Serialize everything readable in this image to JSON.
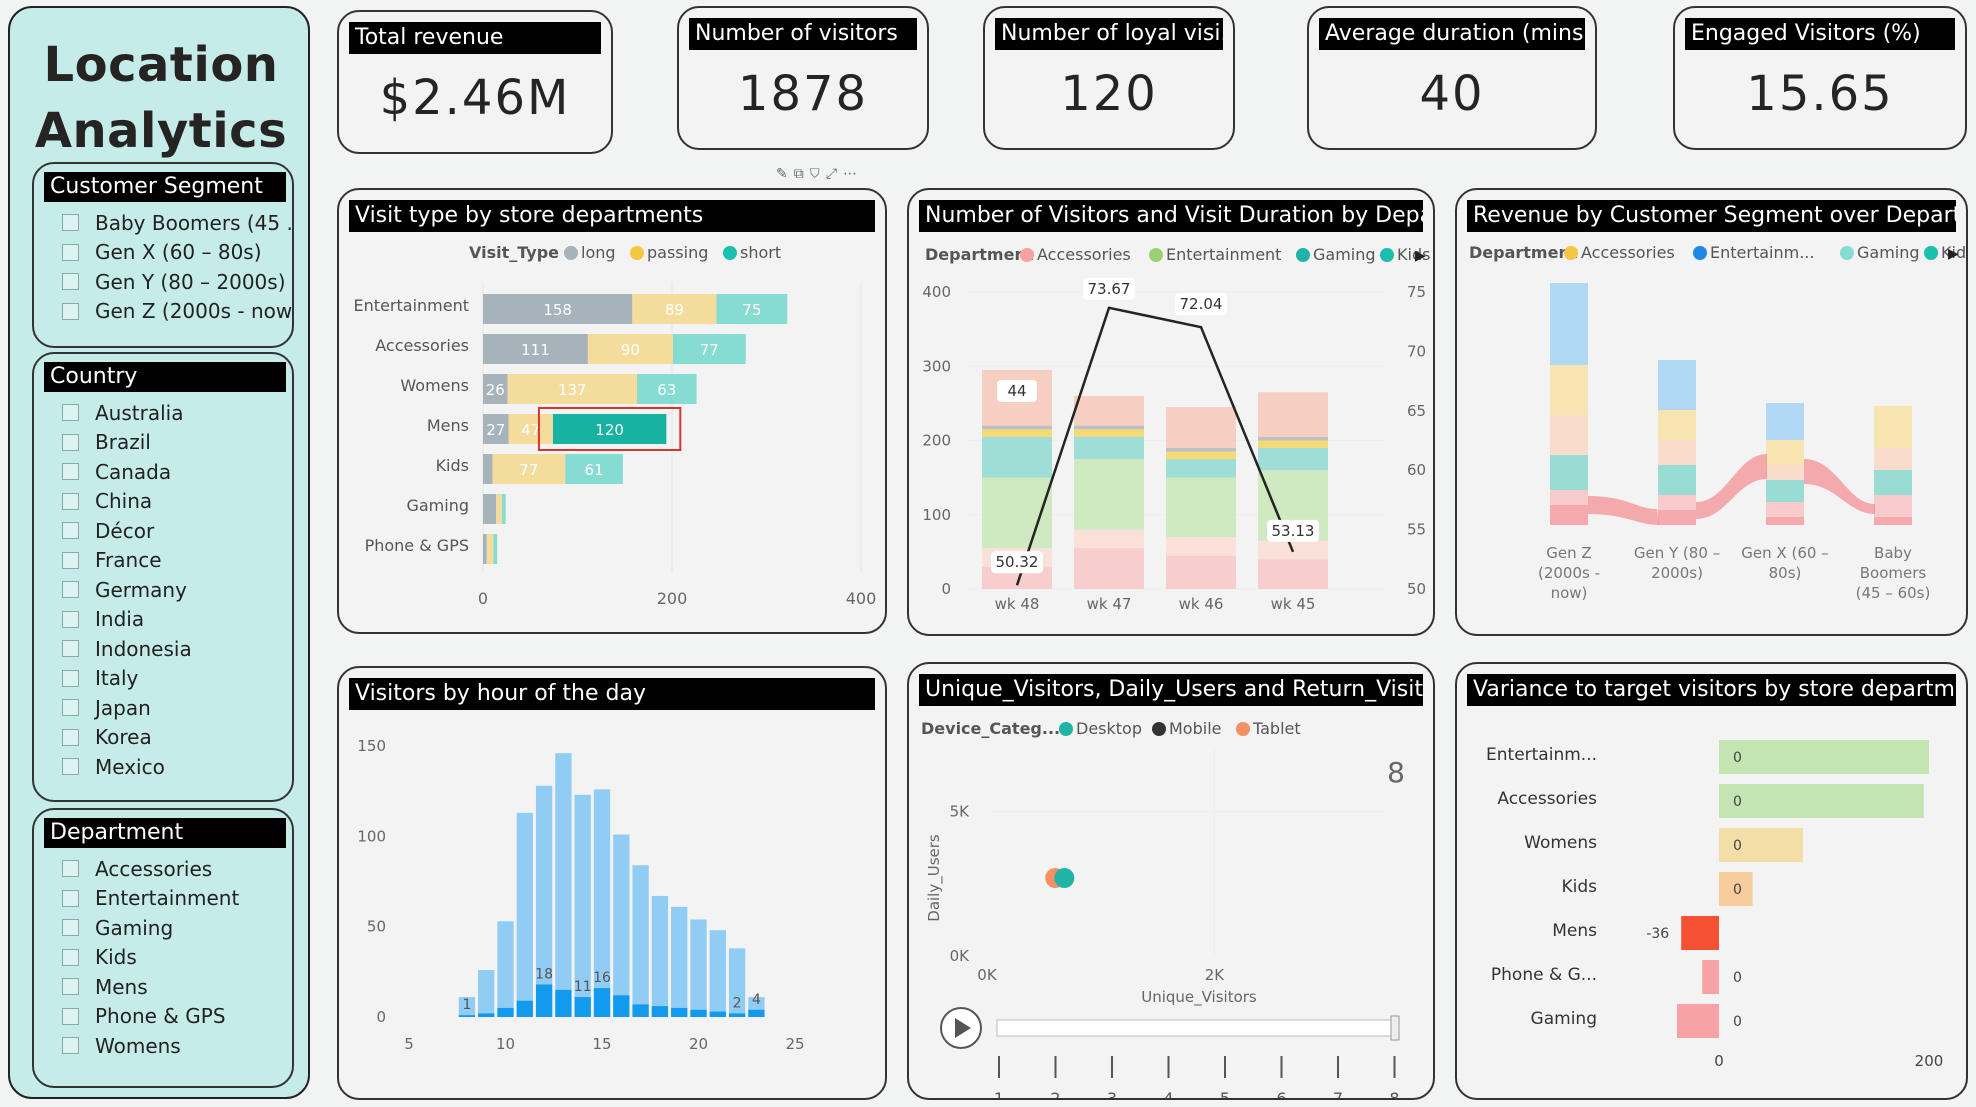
{
  "sidebar": {
    "title_line1": "Location",
    "title_line2": "Analytics"
  },
  "slicers": {
    "segment": {
      "title": "Customer Segment",
      "items": [
        "Baby Boomers (45 ...",
        "Gen X (60 – 80s)",
        "Gen Y (80 – 2000s)",
        "Gen Z (2000s - now)"
      ]
    },
    "country": {
      "title": "Country",
      "items": [
        "Australia",
        "Brazil",
        "Canada",
        "China",
        "Décor",
        "France",
        "Germany",
        "India",
        "Indonesia",
        "Italy",
        "Japan",
        "Korea",
        "Mexico"
      ]
    },
    "department": {
      "title": "Department",
      "items": [
        "Accessories",
        "Entertainment",
        "Gaming",
        "Kids",
        "Mens",
        "Phone & GPS",
        "Womens"
      ]
    }
  },
  "kpis": [
    {
      "title": "Total revenue",
      "value": "$2.46M"
    },
    {
      "title": "Number of visitors",
      "value": "1878"
    },
    {
      "title": "Number of loyal visi...",
      "value": "120"
    },
    {
      "title": "Average duration (mins)...",
      "value": "40"
    },
    {
      "title": "Engaged Visitors (%)",
      "value": "15.65"
    }
  ],
  "panels": {
    "visit_type": "Visit type by store departments",
    "visitors_duration": "Number of Visitors and Visit Duration by Depart...",
    "revenue_segment": "Revenue by Customer Segment over Departm...",
    "hourly": "Visitors by hour of the day",
    "unique": "Unique_Visitors, Daily_Users and Return_Visitors...",
    "variance": "Variance to target visitors by store department"
  },
  "colors": {
    "long": "#a7b3bb",
    "passing": "#f4dc9c",
    "short": "#86dbd2",
    "short_selected": "#17b2a2",
    "accessories": "#f5a3a0",
    "entertainment": "#bfe0ad",
    "gaming": "#8fd4d0",
    "kids": "#f6d36a",
    "desktop": "#21b3a6",
    "mobile": "#333333",
    "tablet": "#f58f64",
    "hour_light": "#91ccf5",
    "hour_dark": "#129bee",
    "var_ent": "#c3e5b3",
    "var_wom": "#f3dea8",
    "var_kids": "#f7cd9b",
    "var_mens": "#f45134",
    "var_pink": "#f7a3a5"
  },
  "chart_data": [
    {
      "type": "bar",
      "orientation": "horizontal",
      "stacked": true,
      "legend_title": "Visit_Type",
      "legend_position": "top",
      "categories": [
        "Entertainment",
        "Accessories",
        "Womens",
        "Mens",
        "Kids",
        "Gaming",
        "Phone & GPS"
      ],
      "series": [
        {
          "name": "long",
          "values": [
            158,
            111,
            26,
            27,
            10,
            14,
            4
          ]
        },
        {
          "name": "passing",
          "values": [
            89,
            90,
            137,
            47,
            77,
            6,
            7
          ]
        },
        {
          "name": "short",
          "values": [
            75,
            77,
            63,
            120,
            61,
            4,
            4
          ]
        }
      ],
      "xlim": [
        0,
        400
      ],
      "x_ticks": [
        "0",
        "200",
        "400"
      ],
      "selected": {
        "category": "Mens",
        "series": "short"
      }
    },
    {
      "type": "bar",
      "stacked": true,
      "combo_line": true,
      "legend_title": "Department",
      "legend_position": "top",
      "legend": [
        "Accessories",
        "Entertainment",
        "Gaming",
        "Kids"
      ],
      "categories": [
        "wk 48",
        "wk 47",
        "wk 46",
        "wk 45"
      ],
      "line": {
        "values": [
          50.32,
          73.67,
          72.04,
          53.13
        ],
        "y2lim": [
          50,
          75
        ],
        "y2_ticks": [
          "50",
          "55",
          "60",
          "65",
          "70",
          "75"
        ]
      },
      "ylim": [
        0,
        400
      ],
      "y_ticks": [
        "0",
        "100",
        "200",
        "300",
        "400"
      ],
      "bar_label": "44"
    },
    {
      "type": "bar",
      "stacked": true,
      "ribbon": true,
      "legend_title": "Department",
      "legend_position": "top",
      "legend": [
        "Accessories",
        "Entertainm...",
        "Gaming",
        "Kids"
      ],
      "categories": [
        "Gen Z\n(2000s -\nnow)",
        "Gen Y (80 –\n2000s)",
        "Gen X (60 –\n80s)",
        "Baby\nBoomers\n(45 – 60s)"
      ]
    },
    {
      "type": "bar",
      "x": [
        8,
        9,
        10,
        11,
        12,
        13,
        14,
        15,
        16,
        17,
        18,
        19,
        20,
        21,
        22,
        23
      ],
      "series": [
        {
          "name": "total",
          "values": [
            11,
            26,
            53,
            113,
            128,
            146,
            123,
            126,
            101,
            84,
            67,
            61,
            54,
            48,
            38,
            11
          ]
        },
        {
          "name": "highlight",
          "values": [
            1,
            2,
            5,
            9,
            18,
            15,
            11,
            16,
            12,
            7,
            6,
            5,
            4,
            3,
            2,
            4
          ]
        }
      ],
      "xlim": [
        5,
        25
      ],
      "x_ticks": [
        "5",
        "10",
        "15",
        "20",
        "25"
      ],
      "ylim": [
        0,
        150
      ],
      "y_ticks": [
        "0",
        "50",
        "100",
        "150"
      ],
      "data_labels": [
        {
          "x": 8,
          "label": "1"
        },
        {
          "x": 12,
          "label": "18"
        },
        {
          "x": 14,
          "label": "11"
        },
        {
          "x": 15,
          "label": "16"
        },
        {
          "x": 22,
          "label": "2"
        },
        {
          "x": 23,
          "label": "4"
        }
      ]
    },
    {
      "type": "scatter",
      "legend_title": "Device_Categ...",
      "legend": [
        "Desktop",
        "Mobile",
        "Tablet"
      ],
      "xlabel": "Unique_Visitors",
      "ylabel": "Daily_Users",
      "x_ticks": [
        "0K",
        "2K"
      ],
      "y_ticks": [
        "0K",
        "5K"
      ],
      "xlim": [
        0,
        3500
      ],
      "ylim": [
        0,
        7200
      ],
      "points": [
        {
          "series": "Tablet",
          "x": 600,
          "y": 2700
        },
        {
          "series": "Mobile",
          "x": 640,
          "y": 2700
        },
        {
          "series": "Desktop",
          "x": 680,
          "y": 2700
        }
      ],
      "play_axis": {
        "ticks": [
          "1",
          "2",
          "3",
          "4",
          "5",
          "6",
          "7",
          "8"
        ],
        "current": "8"
      }
    },
    {
      "type": "bar",
      "orientation": "horizontal",
      "categories": [
        "Entertainm...",
        "Accessories",
        "Womens",
        "Kids",
        "Mens",
        "Phone & G...",
        "Gaming"
      ],
      "values": [
        200,
        195,
        80,
        32,
        -36,
        -16,
        -40
      ],
      "labels": [
        "0",
        "0",
        "0",
        "0",
        "-36",
        "0",
        "0"
      ],
      "xlim": [
        -40,
        210
      ],
      "x_ticks": [
        "0",
        "200"
      ]
    }
  ]
}
